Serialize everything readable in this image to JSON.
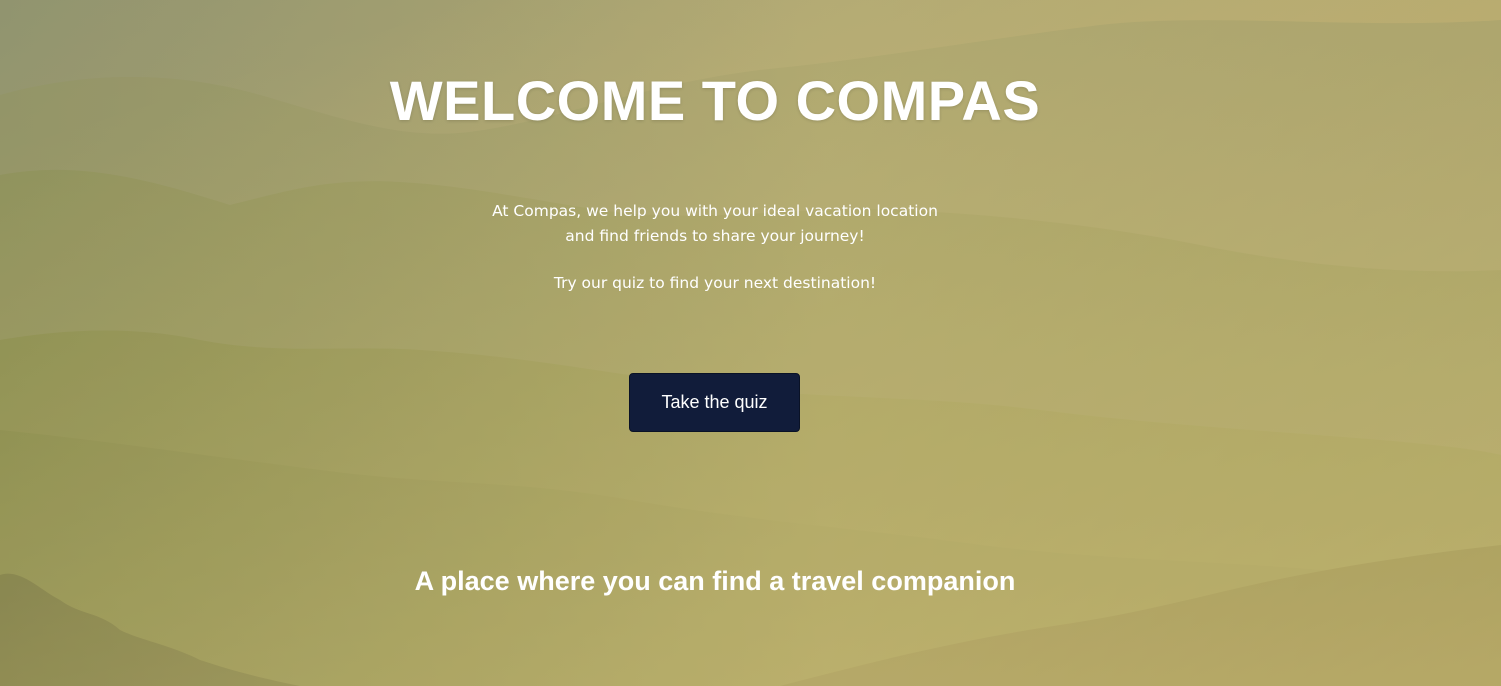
{
  "hero": {
    "title": "WELCOME TO COMPAS",
    "intro_line_1": "At Compas, we help you with your ideal vacation location",
    "intro_line_2": "and find friends to share your journey!",
    "cta_text": "Try our quiz to find your next destination!",
    "quiz_button_label": "Take the quiz",
    "tagline": "A place where you can find a travel companion"
  },
  "background": {
    "image": "misty-forest-mountains",
    "overlay_color": "#b8a45e",
    "button_color": "#111c3a"
  }
}
